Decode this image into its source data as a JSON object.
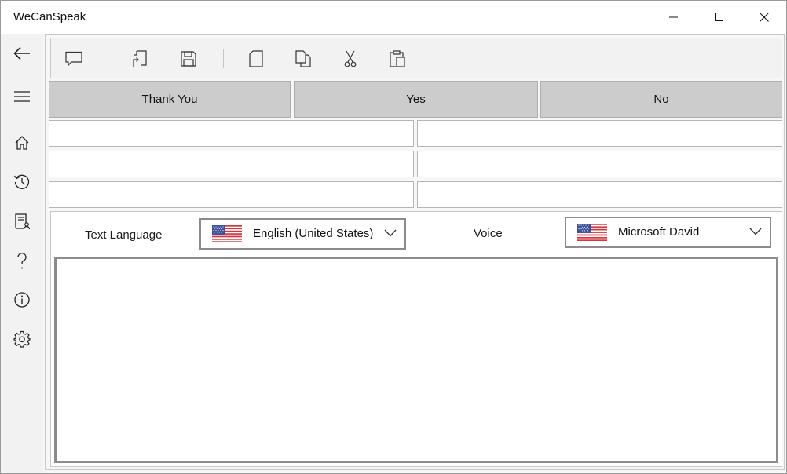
{
  "window": {
    "title": "WeCanSpeak"
  },
  "nav": {
    "items": [
      {
        "name": "back",
        "icon": "back-arrow-icon"
      },
      {
        "name": "menu",
        "icon": "hamburger-icon"
      },
      {
        "name": "home",
        "icon": "home-icon"
      },
      {
        "name": "history",
        "icon": "history-icon"
      },
      {
        "name": "phrasebook",
        "icon": "book-user-icon"
      },
      {
        "name": "help",
        "icon": "question-icon"
      },
      {
        "name": "about",
        "icon": "info-icon"
      },
      {
        "name": "settings",
        "icon": "gear-icon"
      }
    ]
  },
  "toolbar": {
    "buttons": [
      {
        "name": "speak",
        "icon": "speech-bubble-icon"
      },
      {
        "name": "open",
        "icon": "open-file-icon"
      },
      {
        "name": "save",
        "icon": "floppy-disk-icon"
      },
      {
        "name": "new",
        "icon": "blank-page-icon"
      },
      {
        "name": "copy",
        "icon": "copy-icon"
      },
      {
        "name": "cut",
        "icon": "scissors-icon"
      },
      {
        "name": "paste",
        "icon": "clipboard-icon"
      }
    ]
  },
  "phrases": {
    "thank_you": "Thank You",
    "yes": "Yes",
    "no": "No"
  },
  "phrase_fields": [
    {
      "value": ""
    },
    {
      "value": ""
    },
    {
      "value": ""
    },
    {
      "value": ""
    },
    {
      "value": ""
    },
    {
      "value": ""
    }
  ],
  "language": {
    "label": "Text Language",
    "selected": "English (United States)",
    "flag": "us-flag-icon"
  },
  "voice": {
    "label": "Voice",
    "selected": "Microsoft David",
    "flag": "us-flag-icon"
  },
  "speak_text": {
    "value": ""
  },
  "colors": {
    "phrase_button_bg": "#cccccc",
    "nav_bg": "#f2f2f2",
    "border": "#8c8c8c"
  }
}
